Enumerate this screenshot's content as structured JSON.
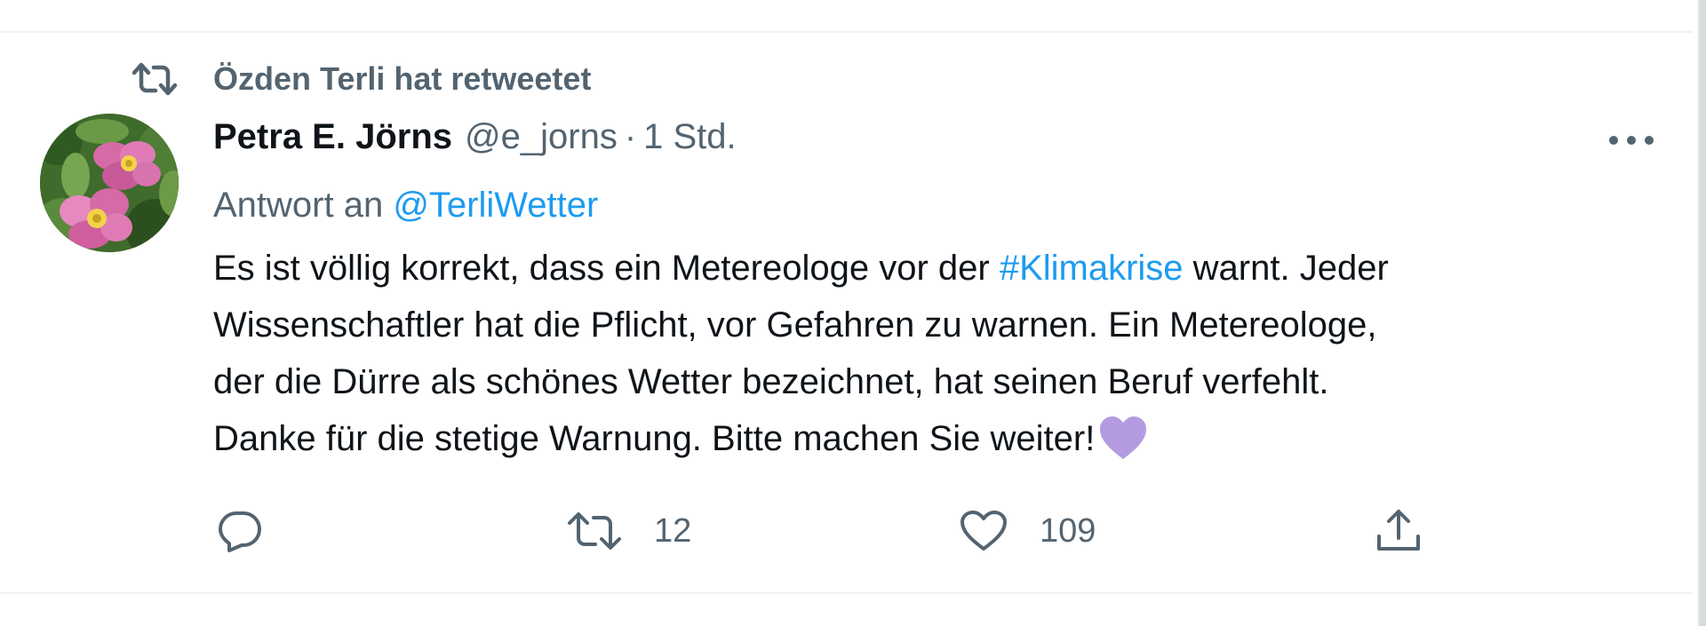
{
  "context": {
    "icon": "retweet-icon",
    "text": "Özden Terli hat retweetet"
  },
  "tweet": {
    "avatar_icon": "avatar-flower-photo",
    "author_name": "Petra E. Jörns",
    "author_handle": "@e_jorns",
    "separator": "·",
    "timestamp": "1 Std.",
    "reply_prefix": "Antwort an ",
    "reply_to": "@TerliWetter",
    "body": {
      "line1_before": "Es ist völlig korrekt, dass ein Metereologe vor der ",
      "hashtag": "#Klimakrise",
      "line1_after": " warnt. Jeder",
      "line2": "Wissenschaftler hat die Pflicht, vor Gefahren zu warnen. Ein Metereologe,",
      "line3": "der die Dürre als schönes Wetter bezeichnet, hat seinen Beruf verfehlt.",
      "line4": "Danke für die stetige Warnung. Bitte machen Sie weiter!",
      "emoji": "purple-heart-icon"
    },
    "actions": {
      "reply": {
        "icon": "reply-icon",
        "count": ""
      },
      "retweet": {
        "icon": "retweet-icon",
        "count": "12"
      },
      "like": {
        "icon": "heart-icon",
        "count": "109"
      },
      "share": {
        "icon": "share-icon",
        "count": ""
      }
    },
    "more_icon": "more-options-icon"
  },
  "colors": {
    "text_primary": "#0f1419",
    "text_secondary": "#536471",
    "link": "#1d9bf0",
    "emoji_purple": "#b49be0"
  }
}
